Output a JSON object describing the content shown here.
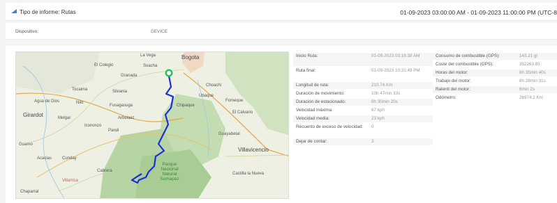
{
  "header": {
    "title": "Tipo de informe: Rutas",
    "range": "01-09-2023 03:00:00 AM - 01-09-2023 11:00:00 PM (UTC-8"
  },
  "device": {
    "label": "Dispositivo:",
    "value": "DEVICE"
  },
  "map": {
    "labels": {
      "bogota": "Bogota",
      "la_vega": "La Vega",
      "el_colegio": "El Colegio",
      "soacha": "Soacha",
      "granada": "Granada",
      "tocaima": "Tocaima",
      "silvania": "Silvania",
      "girardot": "Girardot",
      "agua_de_dios": "Agua de Dios",
      "nilo": "Nilo",
      "fusagasuga": "Fusagasuga",
      "arbelaez": "Arbelaez",
      "pandi": "Pandi",
      "icononzo": "Icononzo",
      "melgar": "Melgar",
      "cunday": "Cunday",
      "villarrica": "Villarrica",
      "cabrera": "Cabrera",
      "villavicencio": "Villavicencio",
      "guayabetal": "Guayabetal",
      "chipaque": "Chipaque",
      "ubaque": "Ubaque",
      "el_calvario": "El Calvario",
      "fomeque": "Fomeque",
      "choachi": "Choachi",
      "park": "Parque Nacional Natural Sumapaz",
      "acacias": "Acacias",
      "castilla": "Castilla la Nueva",
      "guamo": "Guamo",
      "chaparral": "Chaparral"
    },
    "route_color": "#1a2fd6",
    "marker_color": "#2fbf5a"
  },
  "stats_left": [
    {
      "key": "Inicio Ruta:",
      "value": "01-09-2023 03:18:38 AM"
    },
    {
      "key": "Ruta final:",
      "value": "01-09-2023 10:31:49 PM"
    },
    {
      "key": "Longitud de ruta:",
      "value": "210.74 Km"
    },
    {
      "key": "Duración de movimiento:",
      "value": "10h 47min 33s"
    },
    {
      "key": "Duración de estacionado:",
      "value": "8h 30min 20s"
    },
    {
      "key": "Velocidad máxima:",
      "value": "67 kph"
    },
    {
      "key": "Velocidad media:",
      "value": "23 kph"
    },
    {
      "key": "Recuento de exceso de velocidad:",
      "value": "0"
    },
    {
      "key": "Dejar de contar:",
      "value": "3"
    }
  ],
  "stats_right": [
    {
      "key": "Consumo de combustible (GPS):",
      "value": "143.21 gl"
    },
    {
      "key": "Coste del combustible (GPS):",
      "value": "352263.85"
    },
    {
      "key": "Horas del motor:",
      "value": "8h 35min 40s"
    },
    {
      "key": "Trabajo del motor:",
      "value": "8h 28min 31s"
    },
    {
      "key": "Ralentí del motor:",
      "value": "6min 2s"
    },
    {
      "key": "Odómetro:",
      "value": "26974.2 Km"
    }
  ]
}
